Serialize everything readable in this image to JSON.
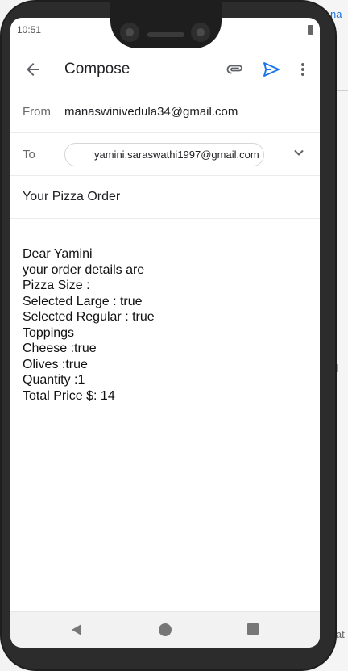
{
  "status_bar": {
    "time": "10:51"
  },
  "appbar": {
    "title": "Compose"
  },
  "email": {
    "from_label": "From",
    "from_value": "manaswinivedula34@gmail.com",
    "to_label": "To",
    "to_value": "yamini.saraswathi1997@gmail.com",
    "subject": "Your Pizza Order",
    "body_lines": [
      "Dear Yamini",
      "your order details are",
      "Pizza Size :",
      "Selected Large : true",
      "Selected Regular : true",
      "Toppings",
      "Cheese :true",
      "Olives :true",
      "Quantity :1",
      "Total Price $: 14"
    ]
  },
  "desktop_fragments": {
    "top": "na",
    "bottom": "lat"
  },
  "colors": {
    "accent": "#1a73e8",
    "text": "#202124",
    "label": "#6b6b6b"
  },
  "icons": {
    "back": "arrow-left-icon",
    "attach": "paperclip-icon",
    "send": "send-icon",
    "more": "more-vertical-icon",
    "expand": "chevron-down-icon"
  }
}
